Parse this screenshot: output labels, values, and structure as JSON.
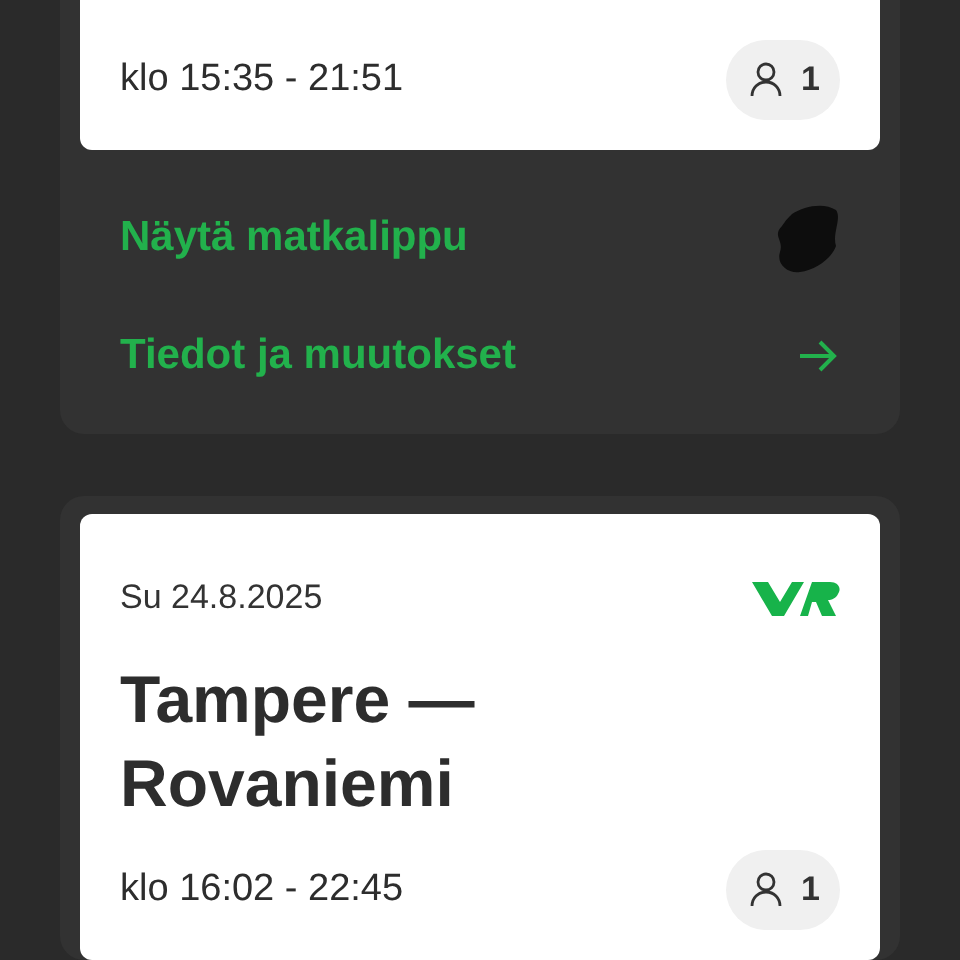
{
  "trips": [
    {
      "time": "klo 15:35 - 21:51",
      "passengers": "1",
      "actions": [
        {
          "label": "Näytä matkalippu",
          "kind": "ticket"
        },
        {
          "label": "Tiedot ja muutokset",
          "kind": "arrow"
        }
      ]
    },
    {
      "date": "Su 24.8.2025",
      "route": "Tampere — Rovaniemi",
      "time": "klo 16:02 - 22:45",
      "passengers": "1"
    }
  ]
}
